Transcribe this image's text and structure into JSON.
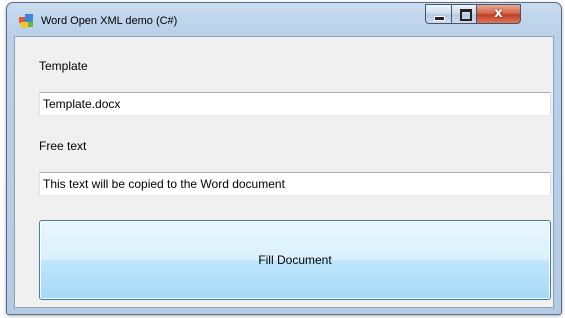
{
  "window": {
    "title": "Word Open XML demo (C#)",
    "icon": "windows-form-icon",
    "controls": {
      "minimize": "minimize-icon",
      "maximize": "maximize-icon",
      "close": "close-icon",
      "close_glyph": "x"
    }
  },
  "form": {
    "template_label": "Template",
    "template_value": "Template.docx",
    "free_text_label": "Free text",
    "free_text_value": "This text will be copied to the Word document",
    "fill_button_label": "Fill Document"
  },
  "colors": {
    "titlebar": "#b9d0e8",
    "client_background": "#f0f0f0",
    "button_border": "#3c7fb1",
    "close_button": "#c43e24"
  }
}
